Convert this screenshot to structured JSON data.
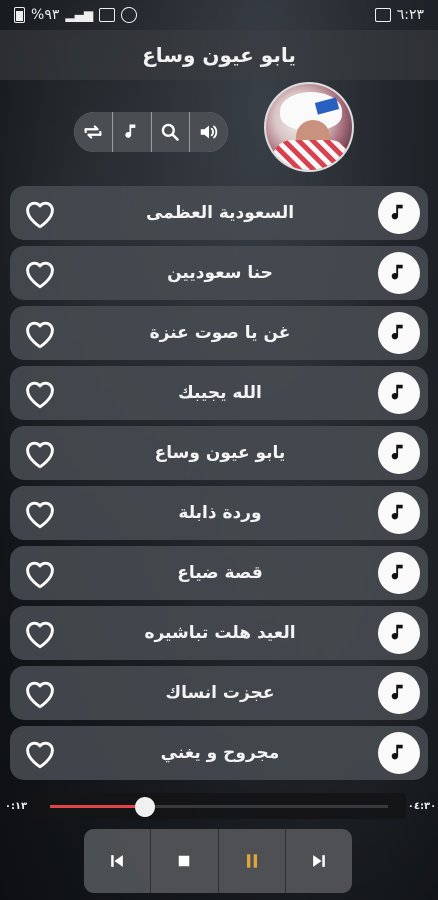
{
  "status_bar": {
    "time": "٦:٢٣",
    "battery": "%٩٣"
  },
  "header": {
    "title": "يابو عيون وساع"
  },
  "toolbar": {
    "buttons": [
      {
        "icon": "repeat-icon"
      },
      {
        "icon": "music-note-icon"
      },
      {
        "icon": "search-icon"
      },
      {
        "icon": "volume-icon"
      }
    ]
  },
  "songs": [
    {
      "title": "السعودية العظمى"
    },
    {
      "title": "حنا سعوديين"
    },
    {
      "title": "غن يا صوت عنزة"
    },
    {
      "title": "الله يجيبك"
    },
    {
      "title": "يابو عيون وساع"
    },
    {
      "title": "وردة ذابلة"
    },
    {
      "title": "قصة ضياع"
    },
    {
      "title": "العيد هلت تباشيره"
    },
    {
      "title": "عجزت انساك"
    },
    {
      "title": "مجروح و يغني"
    }
  ],
  "player": {
    "elapsed": "٠:١٣",
    "duration": "٠٤:٣٠",
    "progress": 0.28
  },
  "colors": {
    "accent": "#e3444a",
    "row_bg": "#4a4e54",
    "pause_icon": "#e0a63a"
  }
}
